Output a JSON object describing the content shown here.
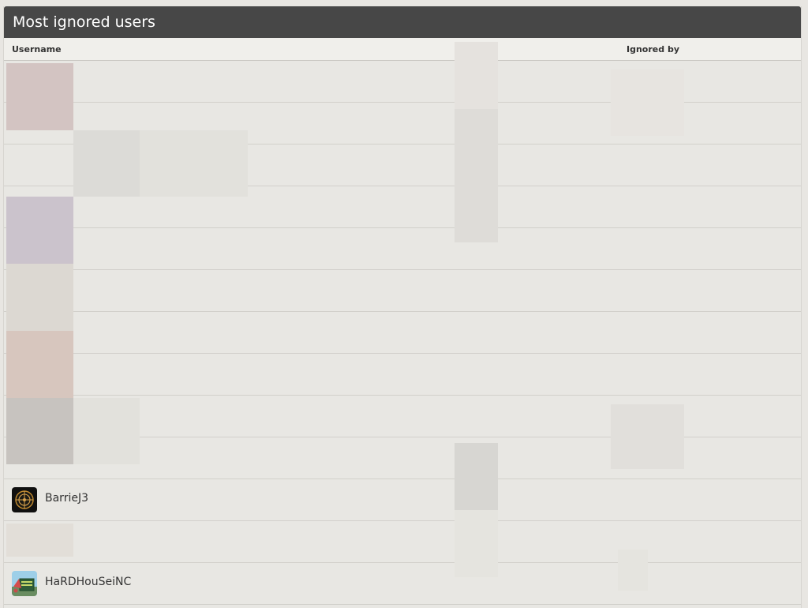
{
  "panel": {
    "title": "Most ignored users"
  },
  "table": {
    "headers": {
      "username": "Username",
      "ignored_by": "Ignored by"
    },
    "rows": [
      {
        "username": ""
      },
      {
        "username": ""
      },
      {
        "username": ""
      },
      {
        "username": ""
      },
      {
        "username": ""
      },
      {
        "username": ""
      },
      {
        "username": ""
      },
      {
        "username": ""
      },
      {
        "username": ""
      },
      {
        "username": ""
      },
      {
        "username": "BarrieJ3"
      },
      {
        "username": ""
      },
      {
        "username": "HaRDHouSeiNC"
      }
    ]
  }
}
